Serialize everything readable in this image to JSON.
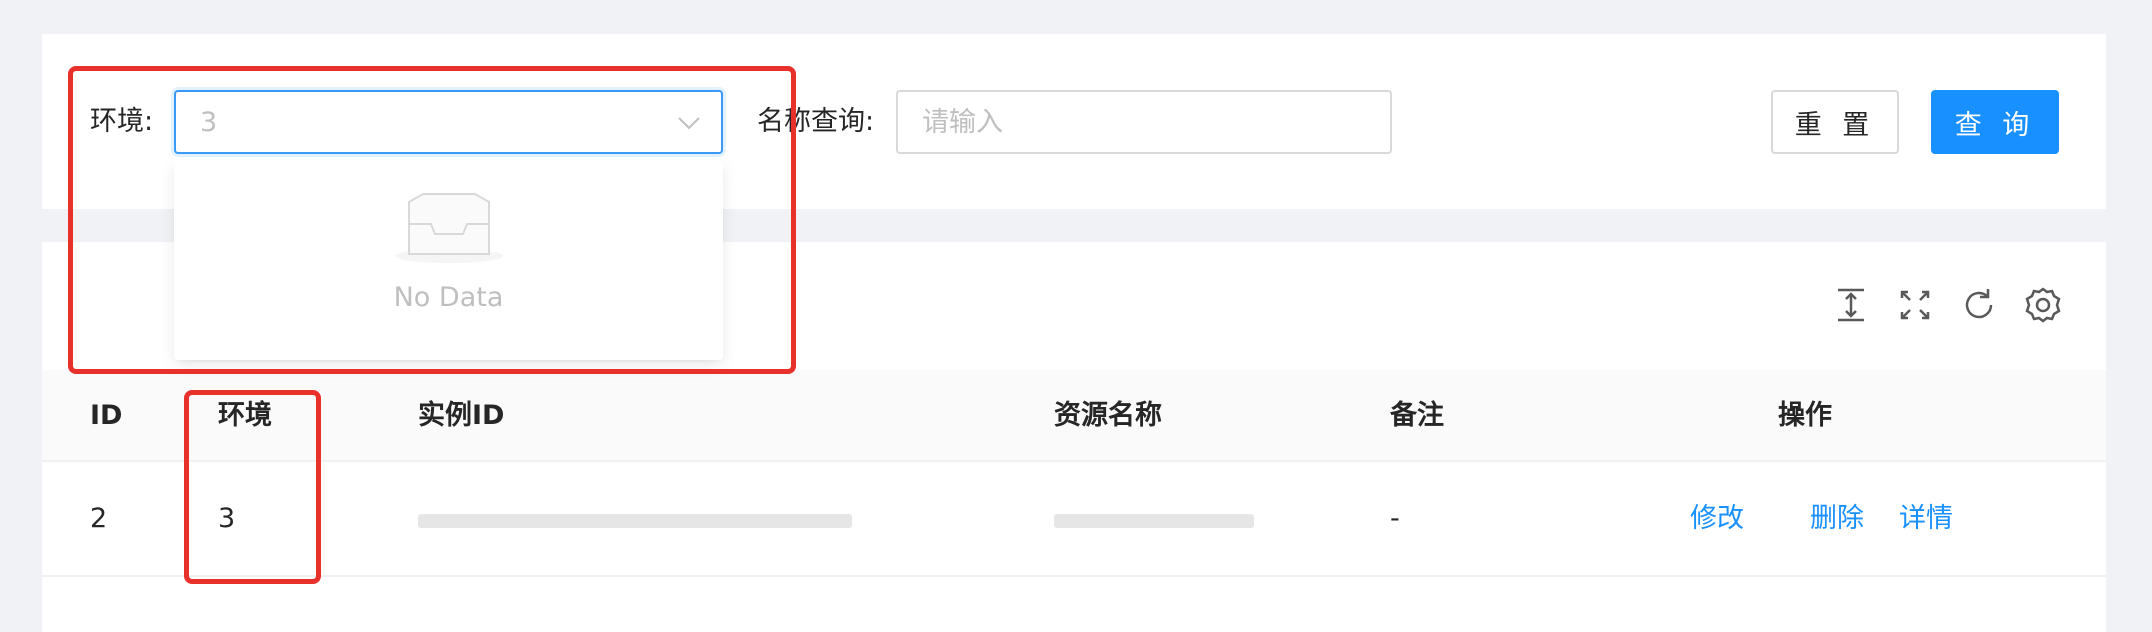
{
  "search": {
    "env_label": "环境:",
    "env_value": "3",
    "name_label": "名称查询:",
    "name_placeholder": "请输入",
    "reset_label": "重 置",
    "query_label": "查 询"
  },
  "dropdown": {
    "empty_text": "No Data"
  },
  "toolbar": {
    "icons": [
      "column-height-icon",
      "fullscreen-icon",
      "reload-icon",
      "settings-icon"
    ]
  },
  "table": {
    "headers": [
      "ID",
      "环境",
      "实例ID",
      "资源名称",
      "备注",
      "操作"
    ],
    "rows": [
      {
        "id": "2",
        "env": "3",
        "instance_id": "",
        "resource_name": "",
        "remark": "-",
        "actions": [
          "修改",
          "删除",
          "详情"
        ]
      }
    ]
  },
  "colors": {
    "primary": "#1890ff",
    "annotation": "#e8312a",
    "background": "#f0f2f5"
  }
}
